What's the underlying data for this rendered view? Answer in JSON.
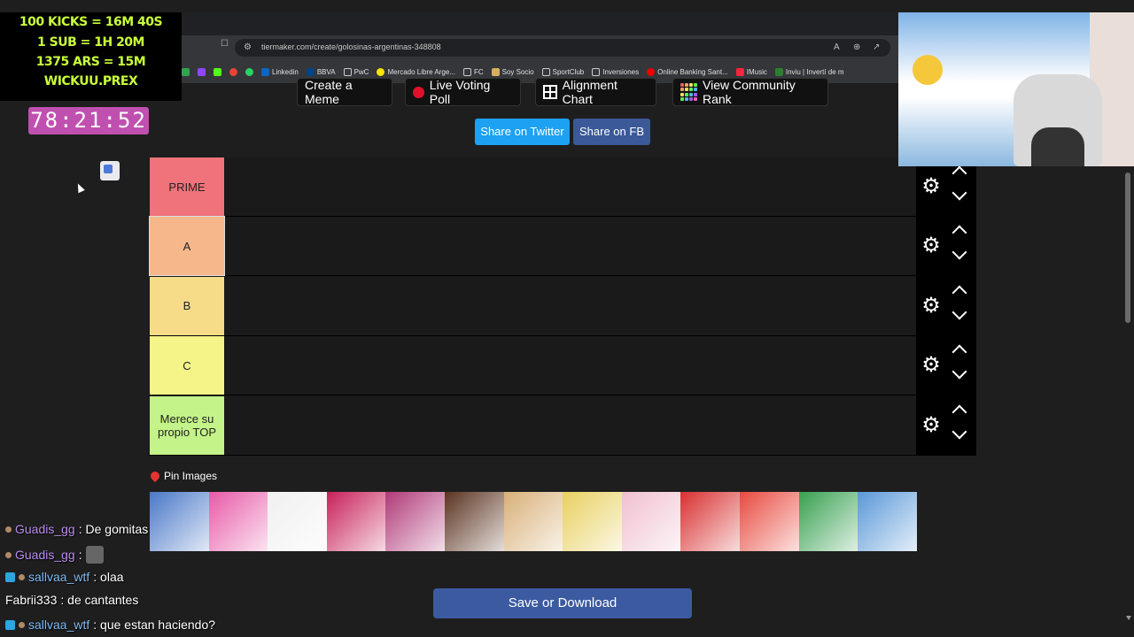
{
  "overlay": {
    "line1": "100 KICKS = 16M 40S",
    "line2": "1 SUB = 1H 20M",
    "line3": "1375 ARS = 15M",
    "line4": "WICKUU.PREX",
    "timer": "78:21:52"
  },
  "browser": {
    "url": "tiermaker.com/create/golosinas-argentinas-348808",
    "bookmarks": [
      "Linkedin",
      "BBVA",
      "PwC",
      "Mercado Libre Arge...",
      "FC",
      "Soy Socio",
      "SportClub",
      "Inversiones",
      "Online Banking Sant...",
      "IMusic",
      "Inviu | Invertí de m"
    ]
  },
  "toolbar": {
    "create_meme": "Create a Meme",
    "live_voting": "Live Voting Poll",
    "alignment_chart": "Alignment Chart",
    "community_rank": "View Community Rank",
    "share_twitter": "Share on Twitter",
    "share_fb": "Share on FB"
  },
  "tiers": [
    {
      "label": "PRIME",
      "color": "#f0727a"
    },
    {
      "label": "A",
      "color": "#f6b88a"
    },
    {
      "label": "B",
      "color": "#f6dc88"
    },
    {
      "label": "C",
      "color": "#f4f488"
    },
    {
      "label": "Merece su propio TOP",
      "color": "#c3f389"
    }
  ],
  "pin_images_label": "Pin Images",
  "images": [
    {
      "name": "candy-1",
      "color": "#4a78c8"
    },
    {
      "name": "candy-2",
      "color": "#e85aa8"
    },
    {
      "name": "candy-3",
      "color": "#f0f0f0"
    },
    {
      "name": "candy-4",
      "color": "#c8205a"
    },
    {
      "name": "candy-5",
      "color": "#b03a78"
    },
    {
      "name": "candy-6",
      "color": "#5a3320"
    },
    {
      "name": "candy-7",
      "color": "#d8b078"
    },
    {
      "name": "candy-8",
      "color": "#e8d060"
    },
    {
      "name": "candy-9",
      "color": "#f0c0d0"
    },
    {
      "name": "candy-10",
      "color": "#d83030"
    },
    {
      "name": "candy-11",
      "color": "#e84a40"
    },
    {
      "name": "candy-12",
      "color": "#38a050"
    },
    {
      "name": "candy-13",
      "color": "#5a98d8"
    }
  ],
  "save_button": "Save or Download",
  "chat": [
    {
      "user": "Guadis_gg",
      "msg": ": De gomitas",
      "user_color": "#b98af0"
    },
    {
      "user": "Guadis_gg",
      "msg": ":",
      "user_color": "#b98af0"
    },
    {
      "user": "sallvaa_wtf",
      "msg": ": olaa",
      "user_color": "#7fb8f0"
    },
    {
      "user": "Fabrii333",
      "msg": ": de cantantes",
      "user_color": "#ffffff"
    },
    {
      "user": "sallvaa_wtf",
      "msg": ": que estan haciendo?",
      "user_color": "#7fb8f0"
    }
  ]
}
